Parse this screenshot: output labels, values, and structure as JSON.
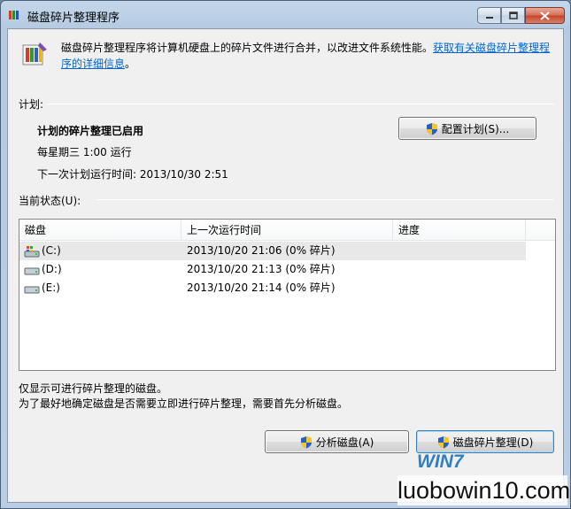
{
  "window": {
    "title": "磁盘碎片整理程序",
    "app_icon": "defrag-app-icon",
    "controls": {
      "minimize": "minimize-icon",
      "maximize": "maximize-icon",
      "close": "close-icon"
    }
  },
  "intro": {
    "text": "磁盘碎片整理程序将计算机硬盘上的碎片文件进行合并，以改进文件系统性能。",
    "link": "获取有关磁盘碎片整理程序的详细信息",
    "period": "。"
  },
  "schedule": {
    "group_label": "计划:",
    "status": "计划的碎片整理已启用",
    "frequency": "每星期三  1:00 运行",
    "next_run": "下一次计划运行时间: 2013/10/30 2:51",
    "configure_button": "配置计划(S)..."
  },
  "current_status": {
    "group_label": "当前状态(U):",
    "columns": [
      "磁盘",
      "上一次运行时间",
      "进度"
    ],
    "disks": [
      {
        "name": "(C:)",
        "last_run": "2013/10/20 21:06 (0% 碎片)",
        "progress": "",
        "icon": "system-drive-icon"
      },
      {
        "name": "(D:)",
        "last_run": "2013/10/20 21:13 (0% 碎片)",
        "progress": "",
        "icon": "hard-drive-icon"
      },
      {
        "name": "(E:)",
        "last_run": "2013/10/20 21:14 (0% 碎片)",
        "progress": "",
        "icon": "hard-drive-icon"
      }
    ]
  },
  "notes": {
    "line1": "仅显示可进行碎片整理的磁盘。",
    "line2": "为了最好地确定磁盘是否需要立即进行碎片整理，需要首先分析磁盘。"
  },
  "buttons": {
    "analyze": "分析磁盘(A)",
    "defragment": "磁盘碎片整理(D)",
    "shield_icon": "uac-shield-icon"
  },
  "watermark": {
    "text": "luobowin10.com",
    "badge": "WIN7"
  },
  "colors": {
    "link": "#0066cc",
    "titlebar": "#b9cde4",
    "client": "#f0f0f0"
  }
}
